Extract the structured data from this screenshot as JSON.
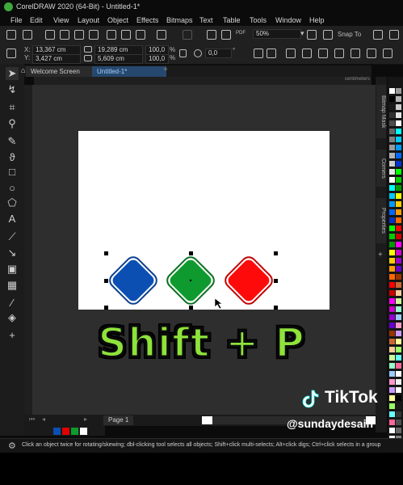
{
  "window": {
    "title": "CorelDRAW 2020 (64-Bit) - Untitled-1*"
  },
  "menu": [
    "File",
    "Edit",
    "View",
    "Layout",
    "Object",
    "Effects",
    "Bitmaps",
    "Text",
    "Table",
    "Tools",
    "Window",
    "Help"
  ],
  "toolbar": {
    "zoom": "50%",
    "snap_label": "Snap To",
    "pdf_label": "PDF"
  },
  "properties": {
    "x": "13,367 cm",
    "y": "3,427 cm",
    "x_label": "X:",
    "y_label": "Y:",
    "w": "19,289 cm",
    "h": "5,609 cm",
    "scale_w": "100,0",
    "scale_h": "100,0",
    "percent": "%",
    "angle": "0,0",
    "angle_unit": "°"
  },
  "tabs": {
    "welcome": "Welcome Screen",
    "doc": "Untitled-1*"
  },
  "ruler": {
    "unit": "centimeters"
  },
  "dockers": {
    "bitmap_mask": "Bitmap Mask",
    "corners": "Corners",
    "properties": "Properties"
  },
  "shapes": [
    {
      "name": "blue-diamond",
      "fill": "#0b4fb3"
    },
    {
      "name": "green-diamond",
      "fill": "#0e9a2e"
    },
    {
      "name": "red-diamond",
      "fill": "#ff0a0a"
    }
  ],
  "pagebar": {
    "page": "Page 1"
  },
  "status": {
    "hint": "Click an object twice for rotating/skewing; dbl-clicking tool selects all objects; Shift+click multi-selects; Alt+click digs; Ctrl+click selects in a group"
  },
  "overlay": {
    "caption": "Shift + P",
    "brand": "TikTok",
    "handle": "@sundaydesain"
  },
  "colors": {
    "accent_green": "#8ee33a",
    "selection": "#000000"
  }
}
